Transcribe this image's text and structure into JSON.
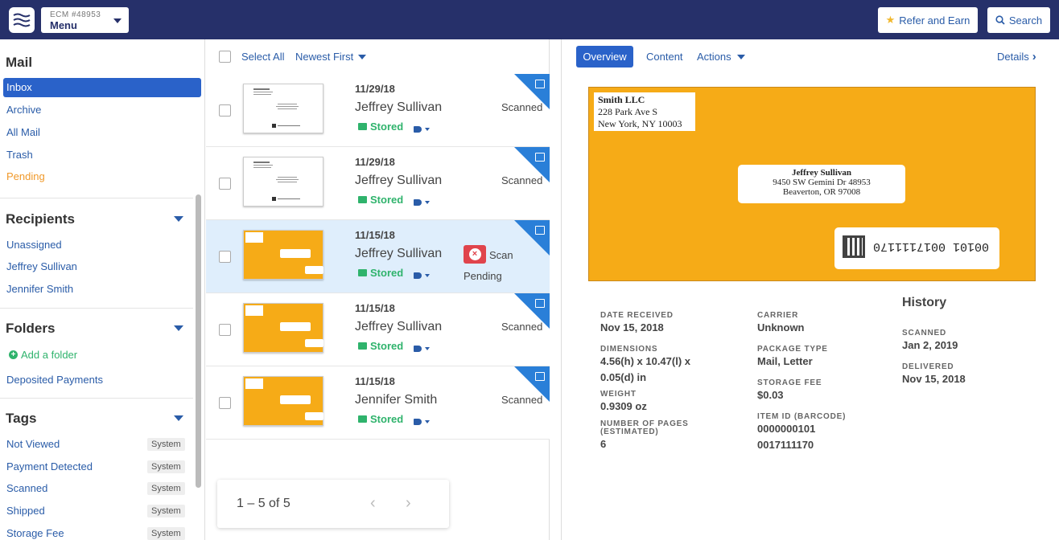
{
  "header": {
    "menu_sub": "ECM #48953",
    "menu_label": "Menu",
    "refer_label": "Refer and Earn",
    "search_label": "Search"
  },
  "sidebar": {
    "mail_title": "Mail",
    "mail_items": [
      "Inbox",
      "Archive",
      "All Mail",
      "Trash",
      "Pending"
    ],
    "recipients_title": "Recipients",
    "recipients": [
      "Unassigned",
      "Jeffrey Sullivan",
      "Jennifer Smith"
    ],
    "folders_title": "Folders",
    "add_folder": "Add a folder",
    "folders": [
      "Deposited Payments"
    ],
    "tags_title": "Tags",
    "tags": [
      {
        "name": "Not Viewed",
        "badge": "System"
      },
      {
        "name": "Payment Detected",
        "badge": "System"
      },
      {
        "name": "Scanned",
        "badge": "System"
      },
      {
        "name": "Shipped",
        "badge": "System"
      },
      {
        "name": "Storage Fee",
        "badge": "System"
      }
    ]
  },
  "list": {
    "select_all": "Select All",
    "sort": "Newest First",
    "rows": [
      {
        "date": "11/29/18",
        "name": "Jeffrey Sullivan",
        "stored": "Stored",
        "status": "Scanned",
        "thumb": "white"
      },
      {
        "date": "11/29/18",
        "name": "Jeffrey Sullivan",
        "stored": "Stored",
        "status": "Scanned",
        "thumb": "white"
      },
      {
        "date": "11/15/18",
        "name": "Jeffrey Sullivan",
        "stored": "Stored",
        "status_line1": "Scan",
        "status_line2": "Pending",
        "thumb": "orange",
        "selected": true
      },
      {
        "date": "11/15/18",
        "name": "Jeffrey Sullivan",
        "stored": "Stored",
        "status": "Scanned",
        "thumb": "orange"
      },
      {
        "date": "11/15/18",
        "name": "Jennifer Smith",
        "stored": "Stored",
        "status": "Scanned",
        "thumb": "orange"
      }
    ],
    "pager_text": "1 – 5 of 5"
  },
  "detail": {
    "tabs": [
      "Overview",
      "Content",
      "Actions"
    ],
    "details_link": "Details",
    "envelope": {
      "sender": [
        "Smith LLC",
        "228 Park Ave S",
        "New York, NY 10003"
      ],
      "recipient": [
        "Jeffrey Sullivan",
        "9450 SW Gemini Dr 48953",
        "Beaverton, OR 97008"
      ],
      "barcode_text": "00101 0017111170"
    },
    "fields": {
      "date_received_label": "DATE RECEIVED",
      "date_received": "Nov 15, 2018",
      "dimensions_label": "DIMENSIONS",
      "dimensions_1": "4.56(h) x 10.47(l) x",
      "dimensions_2": "0.05(d) in",
      "weight_label": "WEIGHT",
      "weight": "0.9309 oz",
      "pages_label_1": "NUMBER OF PAGES",
      "pages_label_2": "(ESTIMATED)",
      "pages": "6",
      "carrier_label": "CARRIER",
      "carrier": "Unknown",
      "package_type_label": "PACKAGE TYPE",
      "package_type": "Mail, Letter",
      "storage_fee_label": "STORAGE FEE",
      "storage_fee": "$0.03",
      "item_id_label": "ITEM ID (BARCODE)",
      "item_id_1": "0000000101",
      "item_id_2": "0017111170"
    },
    "history": {
      "title": "History",
      "scanned_label": "SCANNED",
      "scanned": "Jan 2, 2019",
      "delivered_label": "DELIVERED",
      "delivered": "Nov 15, 2018"
    }
  },
  "colors": {
    "navbar": "#26306a",
    "link": "#2a5ca8",
    "active": "#2a62c9",
    "stored": "#2fb36c",
    "pending": "#f0992a",
    "corner": "#2a7fd8",
    "envelope": "#f6ab17"
  }
}
